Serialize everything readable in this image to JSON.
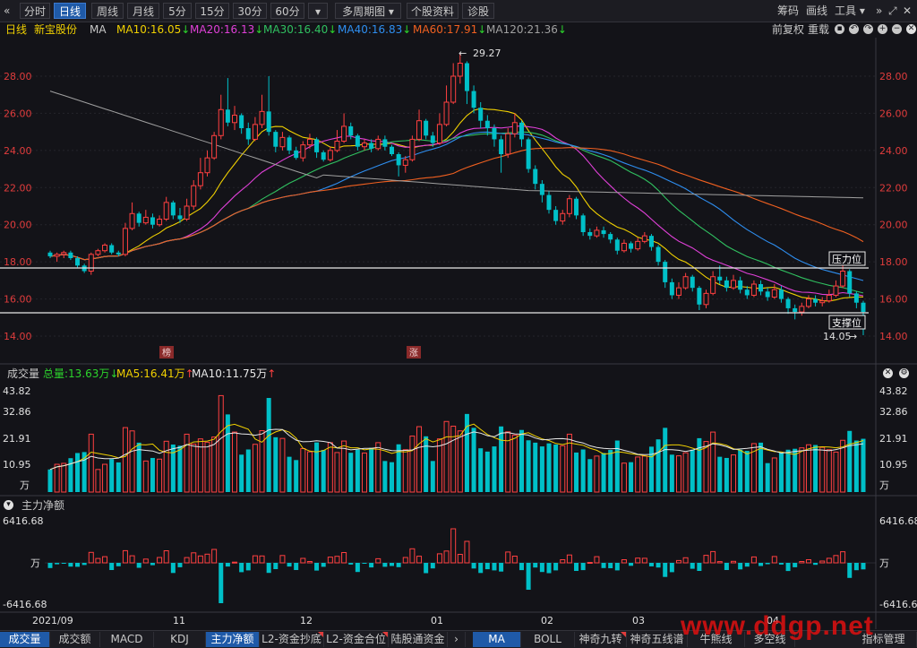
{
  "toolbar": {
    "back_icon": "«",
    "items": [
      {
        "label": "分时",
        "active": false
      },
      {
        "label": "日线",
        "active": true
      },
      {
        "label": "周线",
        "active": false
      },
      {
        "label": "月线",
        "active": false
      },
      {
        "label": "5分",
        "active": false
      },
      {
        "label": "15分",
        "active": false
      },
      {
        "label": "30分",
        "active": false
      },
      {
        "label": "60分",
        "active": false
      },
      {
        "label": "▾",
        "active": false
      },
      {
        "label": "多周期图 ▾",
        "active": false
      },
      {
        "label": "个股资料",
        "active": false
      },
      {
        "label": "诊股",
        "active": false
      }
    ],
    "right": [
      "筹码",
      "画线",
      "工具 ▾",
      "»",
      "⤢",
      "✕"
    ]
  },
  "info": {
    "period": "日线",
    "stock": "新宝股份",
    "ind": "MA",
    "ma": [
      {
        "label": "MA10:16.05",
        "dir": "down",
        "color": "#f0d000"
      },
      {
        "label": "MA20:16.13",
        "dir": "down",
        "color": "#e040d8"
      },
      {
        "label": "MA30:16.40",
        "dir": "down",
        "color": "#30c060"
      },
      {
        "label": "MA40:16.83",
        "dir": "down",
        "color": "#2e8ef0"
      },
      {
        "label": "MA60:17.91",
        "dir": "down",
        "color": "#f06020"
      },
      {
        "label": "MA120:21.36",
        "dir": "down",
        "color": "#a0a0a0"
      }
    ],
    "right": [
      "前复权",
      "重载"
    ],
    "icons": [
      "lock-icon",
      "undo-icon",
      "redo-icon",
      "add-icon",
      "remove-icon"
    ]
  },
  "price_axis": {
    "ticks": [
      "28.00",
      "26.00",
      "24.00",
      "22.00",
      "20.00",
      "18.00",
      "16.00",
      "14.00"
    ]
  },
  "annotations": {
    "high": "29.27",
    "low": "14.05",
    "resist": "压力位",
    "support": "支撑位",
    "tag1": "榜",
    "tag2": "涨"
  },
  "vol_bar": {
    "label": "成交量",
    "total": "总量:13.63万",
    "ma5": "MA5:16.41万",
    "ma10": "MA10:11.75万"
  },
  "vol_axis": {
    "ticks": [
      "43.82",
      "32.86",
      "21.91",
      "10.95"
    ],
    "unit": "万"
  },
  "mf_bar": {
    "label": "主力净额"
  },
  "mf_axis": {
    "top": "6416.68",
    "mid": "万",
    "bottom": "-6416.68"
  },
  "date_axis": [
    "2021/09",
    "11",
    "12",
    "01",
    "02",
    "03",
    "04"
  ],
  "bottom_tabs": [
    "成交量",
    "成交额",
    "MACD",
    "KDJ",
    "主力净额",
    "L2-资金抄底",
    "L2-资金合位",
    "陆股通资金",
    "›",
    "MA",
    "BOLL",
    "神奇九转",
    "神奇五线谱",
    "牛熊线",
    "多空线",
    "指标管理"
  ],
  "watermark": "www.ddgp.net",
  "colors": {
    "up": "#ff4040",
    "down": "#00c0c8",
    "bg": "#131318"
  },
  "chart_data": {
    "type": "candlestick",
    "ylim": [
      13.0,
      30.0
    ],
    "x": [
      "2021/09",
      "11",
      "12",
      "01",
      "02",
      "03",
      "04"
    ],
    "candles": [
      [
        18.5,
        18.3,
        18.6,
        18.2
      ],
      [
        18.3,
        18.4,
        18.5,
        18.0
      ],
      [
        18.4,
        18.5,
        18.6,
        18.2
      ],
      [
        18.5,
        18.2,
        18.6,
        18.1
      ],
      [
        18.2,
        17.8,
        18.3,
        17.7
      ],
      [
        17.8,
        17.5,
        17.9,
        17.4
      ],
      [
        17.5,
        18.4,
        18.5,
        17.3
      ],
      [
        18.4,
        18.6,
        18.7,
        18.3
      ],
      [
        18.6,
        18.9,
        19.0,
        18.5
      ],
      [
        18.9,
        18.5,
        19.0,
        18.4
      ],
      [
        18.5,
        18.4,
        18.6,
        18.3
      ],
      [
        18.4,
        19.8,
        20.1,
        18.3
      ],
      [
        19.8,
        20.6,
        21.2,
        19.7
      ],
      [
        20.6,
        20.1,
        20.7,
        19.9
      ],
      [
        20.1,
        20.4,
        20.8,
        20.0
      ],
      [
        20.4,
        20.0,
        20.6,
        19.8
      ],
      [
        20.0,
        20.3,
        20.5,
        19.9
      ],
      [
        20.3,
        21.2,
        21.5,
        20.2
      ],
      [
        21.2,
        20.5,
        21.3,
        20.3
      ],
      [
        20.5,
        20.3,
        20.9,
        20.1
      ],
      [
        20.3,
        21.0,
        21.4,
        20.2
      ],
      [
        21.0,
        22.1,
        22.4,
        20.8
      ],
      [
        22.1,
        22.8,
        23.6,
        21.9
      ],
      [
        22.8,
        23.6,
        24.0,
        22.6
      ],
      [
        23.6,
        24.8,
        25.0,
        23.5
      ],
      [
        24.8,
        26.2,
        27.0,
        24.6
      ],
      [
        26.2,
        25.5,
        27.9,
        25.3
      ],
      [
        25.5,
        25.9,
        26.4,
        25.1
      ],
      [
        25.9,
        25.2,
        26.0,
        24.9
      ],
      [
        25.2,
        24.6,
        25.5,
        24.3
      ],
      [
        24.6,
        25.4,
        25.8,
        24.5
      ],
      [
        25.4,
        26.1,
        27.0,
        25.2
      ],
      [
        26.1,
        25.0,
        28.0,
        24.8
      ],
      [
        25.0,
        24.2,
        25.1,
        23.9
      ],
      [
        24.2,
        24.7,
        25.0,
        24.0
      ],
      [
        24.7,
        24.0,
        24.8,
        23.8
      ],
      [
        24.0,
        23.6,
        24.2,
        23.5
      ],
      [
        23.6,
        24.3,
        24.5,
        23.4
      ],
      [
        24.3,
        24.6,
        24.9,
        24.1
      ],
      [
        24.6,
        23.9,
        24.7,
        23.6
      ],
      [
        23.9,
        23.5,
        24.0,
        23.4
      ],
      [
        23.5,
        24.0,
        24.2,
        23.4
      ],
      [
        24.0,
        24.5,
        25.1,
        23.9
      ],
      [
        24.5,
        25.3,
        26.0,
        24.4
      ],
      [
        25.3,
        24.8,
        25.5,
        24.6
      ],
      [
        24.8,
        24.2,
        24.9,
        24.0
      ],
      [
        24.2,
        24.4,
        24.6,
        24.0
      ],
      [
        24.4,
        24.1,
        24.6,
        23.9
      ],
      [
        24.1,
        24.6,
        24.8,
        24.0
      ],
      [
        24.6,
        24.2,
        24.8,
        24.0
      ],
      [
        24.2,
        23.8,
        24.3,
        23.7
      ],
      [
        23.8,
        23.2,
        23.9,
        22.6
      ],
      [
        23.2,
        23.5,
        23.7,
        22.8
      ],
      [
        23.5,
        24.6,
        24.8,
        23.4
      ],
      [
        24.6,
        25.6,
        26.2,
        24.5
      ],
      [
        25.6,
        24.8,
        25.7,
        24.6
      ],
      [
        24.8,
        24.4,
        25.0,
        24.2
      ],
      [
        24.4,
        25.4,
        26.0,
        24.3
      ],
      [
        25.4,
        26.6,
        27.5,
        25.3
      ],
      [
        26.6,
        28.0,
        28.7,
        26.5
      ],
      [
        28.0,
        28.7,
        29.27,
        27.6
      ],
      [
        28.7,
        27.2,
        28.8,
        26.5
      ],
      [
        27.2,
        26.3,
        27.5,
        26.0
      ],
      [
        26.3,
        25.6,
        26.6,
        25.2
      ],
      [
        25.6,
        25.2,
        25.9,
        24.8
      ],
      [
        25.2,
        24.6,
        25.4,
        24.2
      ],
      [
        24.6,
        23.8,
        24.8,
        22.8
      ],
      [
        23.8,
        24.9,
        25.2,
        23.6
      ],
      [
        24.9,
        25.5,
        26.0,
        24.7
      ],
      [
        25.5,
        24.6,
        25.6,
        24.2
      ],
      [
        24.6,
        23.0,
        24.7,
        22.8
      ],
      [
        23.0,
        22.2,
        23.2,
        21.9
      ],
      [
        22.2,
        21.6,
        22.4,
        21.2
      ],
      [
        21.6,
        20.8,
        21.8,
        20.6
      ],
      [
        20.8,
        20.2,
        21.0,
        20.0
      ],
      [
        20.2,
        20.6,
        20.8,
        20.0
      ],
      [
        20.6,
        21.4,
        21.6,
        20.4
      ],
      [
        21.4,
        20.5,
        21.5,
        20.3
      ],
      [
        20.5,
        19.6,
        20.6,
        19.4
      ],
      [
        19.6,
        19.4,
        19.8,
        19.2
      ],
      [
        19.4,
        19.7,
        19.9,
        19.3
      ],
      [
        19.7,
        19.5,
        19.9,
        19.3
      ],
      [
        19.5,
        19.2,
        19.6,
        19.0
      ],
      [
        19.2,
        18.6,
        19.3,
        18.4
      ],
      [
        18.6,
        19.0,
        19.2,
        18.5
      ],
      [
        19.0,
        18.7,
        19.1,
        18.5
      ],
      [
        18.7,
        19.1,
        19.3,
        18.6
      ],
      [
        19.1,
        19.4,
        19.6,
        19.0
      ],
      [
        19.4,
        18.8,
        19.5,
        18.6
      ],
      [
        18.8,
        18.0,
        18.9,
        17.8
      ],
      [
        18.0,
        16.9,
        18.1,
        16.6
      ],
      [
        16.9,
        16.2,
        17.1,
        16.0
      ],
      [
        16.2,
        16.6,
        16.9,
        16.0
      ],
      [
        16.6,
        17.2,
        17.4,
        16.5
      ],
      [
        17.2,
        16.6,
        17.3,
        16.4
      ],
      [
        16.6,
        15.7,
        16.7,
        15.4
      ],
      [
        15.7,
        16.3,
        16.5,
        15.5
      ],
      [
        16.3,
        17.2,
        17.5,
        16.2
      ],
      [
        17.2,
        17.0,
        17.8,
        16.8
      ],
      [
        17.0,
        16.6,
        17.2,
        16.4
      ],
      [
        16.6,
        17.0,
        17.3,
        16.5
      ],
      [
        17.0,
        16.5,
        17.2,
        16.3
      ],
      [
        16.5,
        16.2,
        16.7,
        16.0
      ],
      [
        16.2,
        16.8,
        17.0,
        16.1
      ],
      [
        16.8,
        16.4,
        17.0,
        16.2
      ],
      [
        16.4,
        16.1,
        16.6,
        15.9
      ],
      [
        16.1,
        16.5,
        16.8,
        16.0
      ],
      [
        16.5,
        16.0,
        16.7,
        15.8
      ],
      [
        16.0,
        15.5,
        16.1,
        15.2
      ],
      [
        15.5,
        15.3,
        15.7,
        14.9
      ],
      [
        15.3,
        15.6,
        15.8,
        15.1
      ],
      [
        15.6,
        16.0,
        16.2,
        15.5
      ],
      [
        16.0,
        15.8,
        16.2,
        15.6
      ],
      [
        15.8,
        15.9,
        16.1,
        15.6
      ],
      [
        15.9,
        16.2,
        16.5,
        15.8
      ],
      [
        16.2,
        16.7,
        17.0,
        16.1
      ],
      [
        16.7,
        17.5,
        17.8,
        16.6
      ],
      [
        17.5,
        16.3,
        17.6,
        16.1
      ],
      [
        16.3,
        15.8,
        16.4,
        15.5
      ],
      [
        15.8,
        15.3,
        15.9,
        14.05
      ]
    ],
    "volume_ylim": [
      0,
      43.82
    ]
  }
}
